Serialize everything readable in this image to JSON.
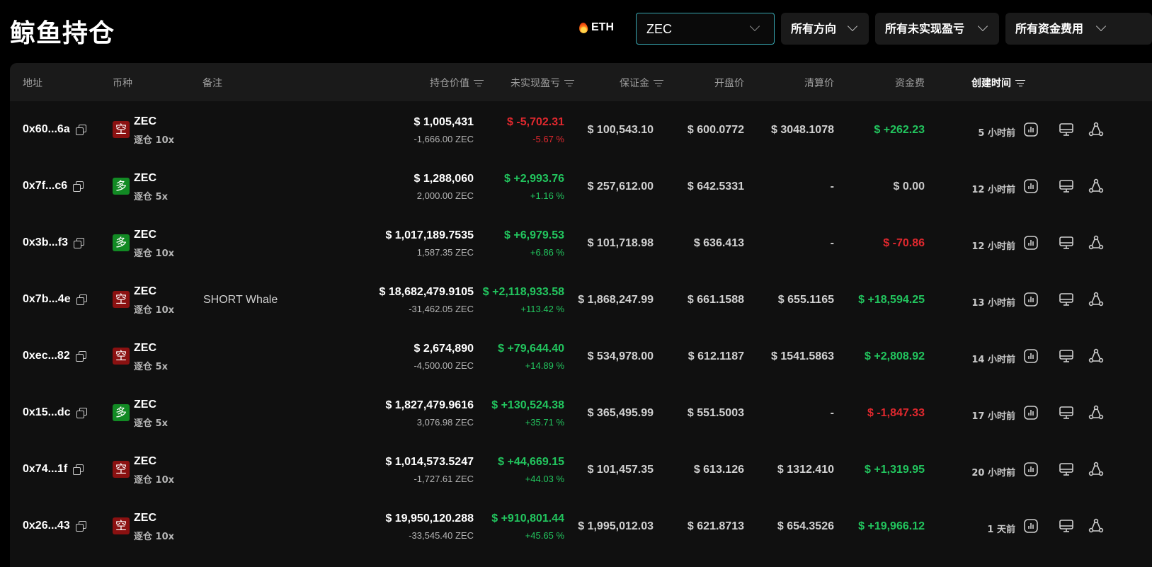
{
  "header": {
    "title": "鲸鱼持仓",
    "eth_chip": "ETH",
    "search_value": "ZEC",
    "filters": {
      "direction": "所有方向",
      "unrealized_pnl": "所有未实现盈亏",
      "funding_fee": "所有资金费用"
    }
  },
  "columns": {
    "address": "地址",
    "coin": "币种",
    "note": "备注",
    "position_value": "持仓价值",
    "unrealized_pnl": "未实现盈亏",
    "margin": "保证金",
    "open_price": "开盘价",
    "liquidation_price": "清算价",
    "funding_fee": "资金费",
    "created_time": "创建时间"
  },
  "rows": [
    {
      "address": "0x60...6a",
      "side": "short",
      "side_label": "空",
      "coin": "ZEC",
      "leverage": "逐仓 10x",
      "note": "",
      "value": "$ 1,005,431",
      "size": "-1,666.00 ZEC",
      "pnl": "$ -5,702.31",
      "pnl_pct": "-5.67 %",
      "pnl_color": "red",
      "margin": "$ 100,543.10",
      "open": "$ 600.0772",
      "liq": "$ 3048.1078",
      "funding": "$ +262.23",
      "funding_color": "green",
      "time": "5 小时前"
    },
    {
      "address": "0x7f...c6",
      "side": "long",
      "side_label": "多",
      "coin": "ZEC",
      "leverage": "逐仓 5x",
      "note": "",
      "value": "$ 1,288,060",
      "size": "2,000.00 ZEC",
      "pnl": "$ +2,993.76",
      "pnl_pct": "+1.16 %",
      "pnl_color": "green",
      "margin": "$ 257,612.00",
      "open": "$ 642.5331",
      "liq": "-",
      "funding": "$ 0.00",
      "funding_color": "grey",
      "time": "12 小时前"
    },
    {
      "address": "0x3b...f3",
      "side": "long",
      "side_label": "多",
      "coin": "ZEC",
      "leverage": "逐仓 10x",
      "note": "",
      "value": "$ 1,017,189.7535",
      "size": "1,587.35 ZEC",
      "pnl": "$ +6,979.53",
      "pnl_pct": "+6.86 %",
      "pnl_color": "green",
      "margin": "$ 101,718.98",
      "open": "$ 636.413",
      "liq": "-",
      "funding": "$ -70.86",
      "funding_color": "red",
      "time": "12 小时前"
    },
    {
      "address": "0x7b...4e",
      "side": "short",
      "side_label": "空",
      "coin": "ZEC",
      "leverage": "逐仓 10x",
      "note": "SHORT Whale",
      "value": "$ 18,682,479.9105",
      "size": "-31,462.05 ZEC",
      "pnl": "$ +2,118,933.58",
      "pnl_pct": "+113.42 %",
      "pnl_color": "green",
      "margin": "$ 1,868,247.99",
      "open": "$ 661.1588",
      "liq": "$ 655.1165",
      "funding": "$ +18,594.25",
      "funding_color": "green",
      "time": "13 小时前"
    },
    {
      "address": "0xec...82",
      "side": "short",
      "side_label": "空",
      "coin": "ZEC",
      "leverage": "逐仓 5x",
      "note": "",
      "value": "$ 2,674,890",
      "size": "-4,500.00 ZEC",
      "pnl": "$ +79,644.40",
      "pnl_pct": "+14.89 %",
      "pnl_color": "green",
      "margin": "$ 534,978.00",
      "open": "$ 612.1187",
      "liq": "$ 1541.5863",
      "funding": "$ +2,808.92",
      "funding_color": "green",
      "time": "14 小时前"
    },
    {
      "address": "0x15...dc",
      "side": "long",
      "side_label": "多",
      "coin": "ZEC",
      "leverage": "逐仓 5x",
      "note": "",
      "value": "$ 1,827,479.9616",
      "size": "3,076.98 ZEC",
      "pnl": "$ +130,524.38",
      "pnl_pct": "+35.71 %",
      "pnl_color": "green",
      "margin": "$ 365,495.99",
      "open": "$ 551.5003",
      "liq": "-",
      "funding": "$ -1,847.33",
      "funding_color": "red",
      "time": "17 小时前"
    },
    {
      "address": "0x74...1f",
      "side": "short",
      "side_label": "空",
      "coin": "ZEC",
      "leverage": "逐仓 10x",
      "note": "",
      "value": "$ 1,014,573.5247",
      "size": "-1,727.61 ZEC",
      "pnl": "$ +44,669.15",
      "pnl_pct": "+44.03 %",
      "pnl_color": "green",
      "margin": "$ 101,457.35",
      "open": "$ 613.126",
      "liq": "$ 1312.410",
      "funding": "$ +1,319.95",
      "funding_color": "green",
      "time": "20 小时前"
    },
    {
      "address": "0x26...43",
      "side": "short",
      "side_label": "空",
      "coin": "ZEC",
      "leverage": "逐仓 10x",
      "note": "",
      "value": "$ 19,950,120.288",
      "size": "-33,545.40 ZEC",
      "pnl": "$ +910,801.44",
      "pnl_pct": "+45.65 %",
      "pnl_color": "green",
      "margin": "$ 1,995,012.03",
      "open": "$ 621.8713",
      "liq": "$ 654.3526",
      "funding": "$ +19,966.12",
      "funding_color": "green",
      "time": "1 天前"
    }
  ]
}
